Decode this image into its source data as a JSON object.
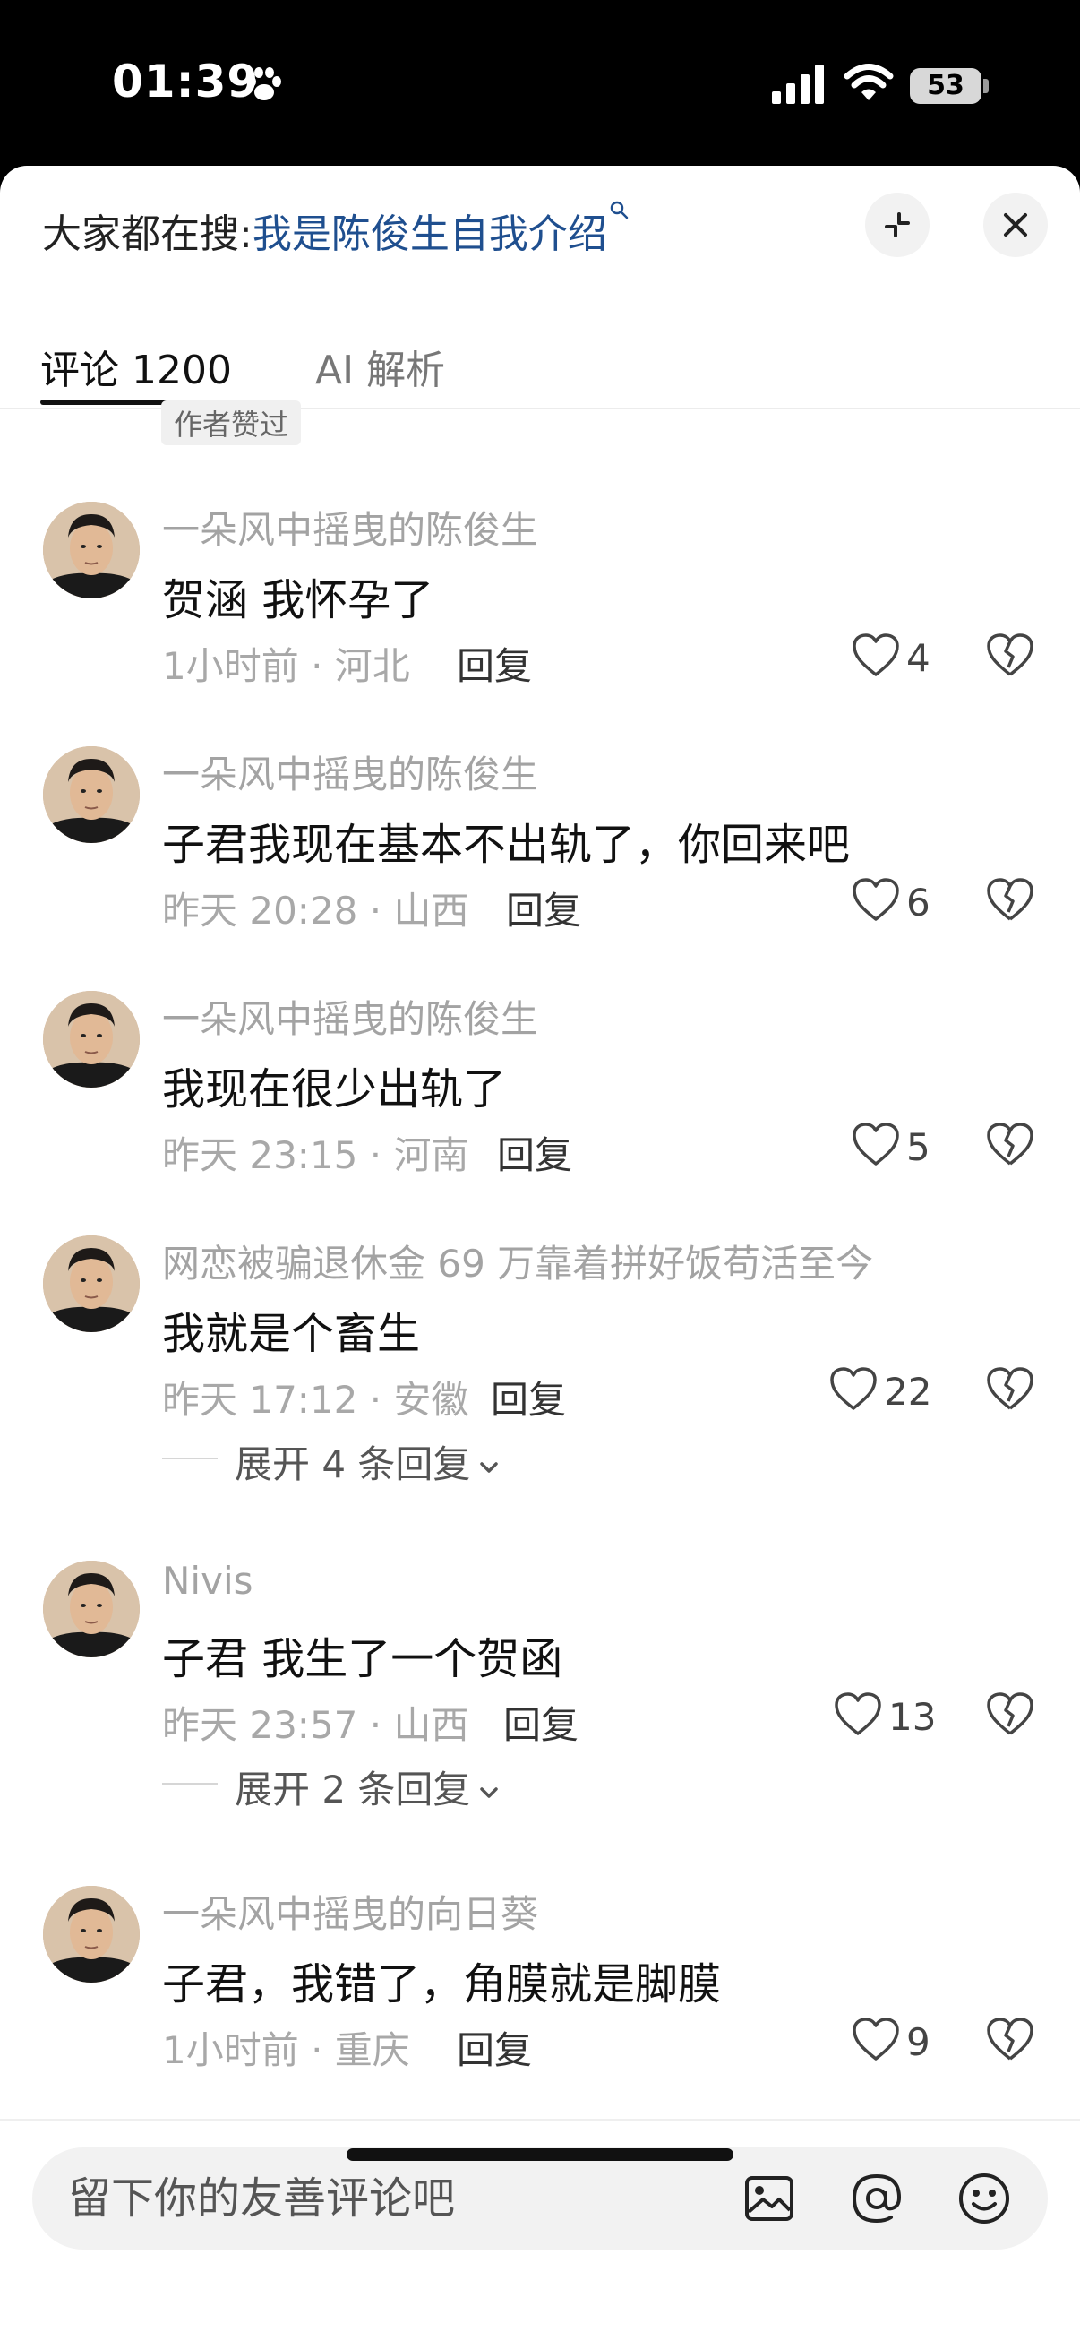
{
  "status_bar": {
    "time": "01:39",
    "battery": "53"
  },
  "header": {
    "search_prefix": "大家都在搜:",
    "search_term": "我是陈俊生自我介绍"
  },
  "tabs": [
    {
      "label": "评论 1200",
      "active": true
    },
    {
      "label": "AI 解析",
      "active": false
    }
  ],
  "author_liked_badge": "作者赞过",
  "comments": [
    {
      "user": "一朵风中摇曳的陈俊生",
      "text": "贺涵 我怀孕了",
      "meta": "1小时前 · 河北",
      "reply": "回复",
      "likes": "4"
    },
    {
      "user": "一朵风中摇曳的陈俊生",
      "text": "子君我现在基本不出轨了，你回来吧",
      "meta": "昨天 20:28 · 山西",
      "reply": "回复",
      "likes": "6"
    },
    {
      "user": "一朵风中摇曳的陈俊生",
      "text": "我现在很少出轨了",
      "meta": "昨天 23:15 · 河南",
      "reply": "回复",
      "likes": "5"
    },
    {
      "user": "网恋被骗退休金 69 万靠着拼好饭苟活至今",
      "text": "我就是个畜生",
      "meta": "昨天 17:12 · 安徽",
      "reply": "回复",
      "likes": "22",
      "expand": "展开 4 条回复"
    },
    {
      "user": "Nivis",
      "text": "子君 我生了一个贺函",
      "meta": "昨天 23:57 · 山西",
      "reply": "回复",
      "likes": "13",
      "expand": "展开 2 条回复"
    },
    {
      "user": "一朵风中摇曳的向日葵",
      "text": "子君，我错了，角膜就是脚膜",
      "meta": "1小时前 · 重庆",
      "reply": "回复",
      "likes": "9"
    }
  ],
  "input": {
    "placeholder": "留下你的友善评论吧"
  },
  "icons": {
    "image": "image-icon",
    "mention": "at-icon",
    "emoji": "emoji-icon",
    "like": "heart-icon",
    "dislike": "broken-heart-icon",
    "close": "close-icon",
    "collapse": "collapse-icon",
    "search": "search-icon"
  },
  "colors": {
    "search_term": "#1f4f8f",
    "meta_gray": "#a8a8a8",
    "text": "#111111"
  }
}
